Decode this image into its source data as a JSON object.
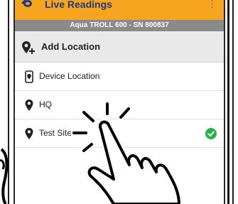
{
  "app": {
    "title": "Live Readings",
    "menu_glyph": "⋮"
  },
  "device": {
    "banner": "Aqua TROLL 600 - SN 800837"
  },
  "header": {
    "add_location_label": "Add Location"
  },
  "locations": [
    {
      "label": "Device Location",
      "icon": "device-location-icon",
      "selected": false
    },
    {
      "label": "HQ",
      "icon": "map-pin-icon",
      "selected": false
    },
    {
      "label": "Test Site #3",
      "icon": "map-pin-icon",
      "selected": true
    }
  ],
  "colors": {
    "app_bar": "#f5a51f",
    "device_bar": "#8a8a8a",
    "header_bg": "#e9e9e9",
    "check_green": "#2ab04a",
    "title_blue": "#1d3b7a"
  },
  "overlay": {
    "gesture": "tap-hand-icon"
  }
}
